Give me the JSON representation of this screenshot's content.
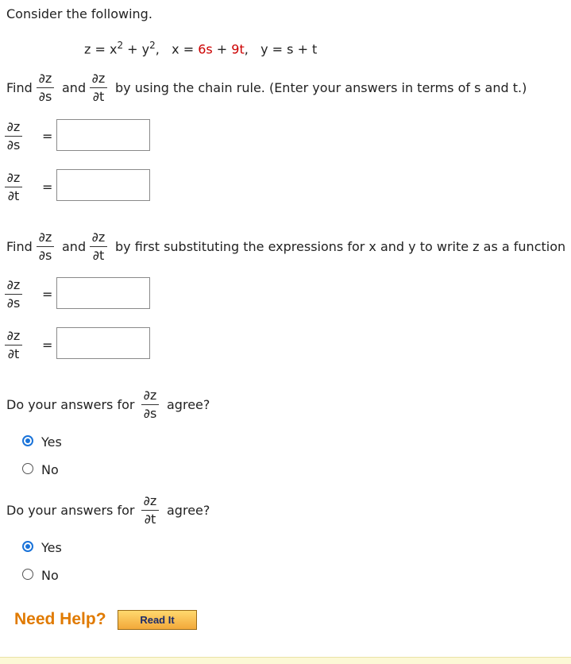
{
  "intro": "Consider the following.",
  "equation": {
    "z": "z = x",
    "sup1": "2",
    "plus": " + y",
    "sup2": "2",
    "comma": ",",
    "x_part": "x = ",
    "x_6s": "6s",
    "x_plus": " + ",
    "x_9t": "9t",
    "x_comma": ",",
    "y_part": "y = s + t"
  },
  "fractions": {
    "dz": "∂z",
    "ds": "∂s",
    "dt": "∂t"
  },
  "section1": {
    "find": "Find",
    "and": "and",
    "instruction": "by using the chain rule. (Enter your answers in terms of s and t.)"
  },
  "section2": {
    "find": "Find",
    "and": "and",
    "instruction": "by first substituting the expressions for x and y to write z as a function"
  },
  "equals": "=",
  "question_s": {
    "prefix": "Do your answers for",
    "suffix": "agree?",
    "options": [
      "Yes",
      "No"
    ],
    "selected": "Yes"
  },
  "question_t": {
    "prefix": "Do your answers for",
    "suffix": "agree?",
    "options": [
      "Yes",
      "No"
    ],
    "selected": "Yes"
  },
  "help": {
    "label": "Need Help?",
    "button": "Read It"
  },
  "colors": {
    "accent_red": "#cc0000",
    "radio_blue": "#1a73d9",
    "help_orange": "#e07a00"
  }
}
